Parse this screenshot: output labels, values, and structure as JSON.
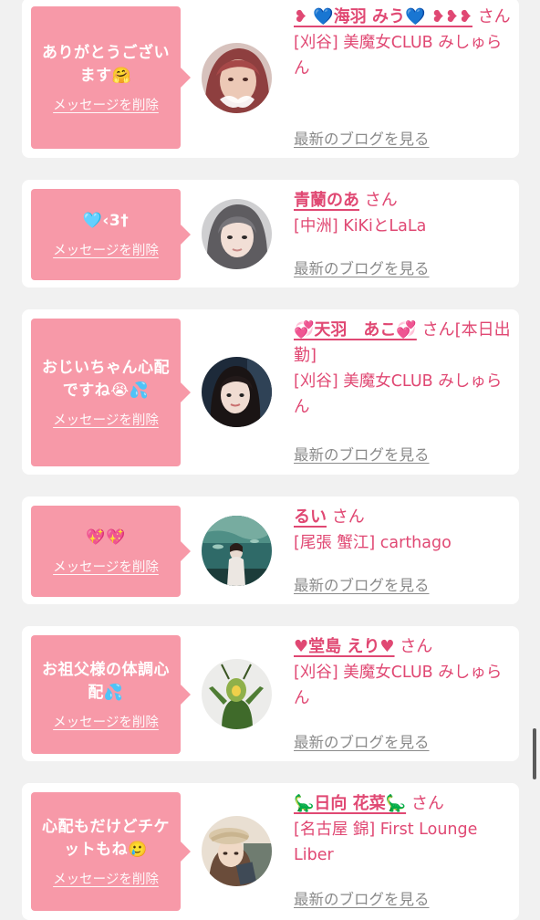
{
  "messages": [
    {
      "bubble_text": "ありがとうござい\nます🤗",
      "delete_label": "メッセージを削除",
      "name": "❥ 💙海羽 みう💙 ❥❥❥",
      "honorific": "さん",
      "extra": "",
      "shop": "[刈谷] 美魔女CLUB みしゅらん",
      "blog_label": "最新のブログを見る",
      "avatar_icon": "woman-portrait-pink-hair"
    },
    {
      "bubble_text": "🩵‹3†",
      "delete_label": "メッセージを削除",
      "name": "青蘭のあ",
      "honorific": "さん",
      "extra": "",
      "shop": "[中洲] KiKiとLaLa",
      "blog_label": "最新のブログを見る",
      "avatar_icon": "woman-portrait-grey-hair"
    },
    {
      "bubble_text": "おじいちゃん心配\nですね😭💦",
      "delete_label": "メッセージを削除",
      "name": "💞天羽　あこ💞",
      "honorific": "さん",
      "extra": "[本日出勤]",
      "shop": "[刈谷] 美魔女CLUB みしゅらん",
      "blog_label": "最新のブログを見る",
      "avatar_icon": "woman-portrait-dark"
    },
    {
      "bubble_text": "💖💖",
      "delete_label": "メッセージを削除",
      "name": "るい",
      "honorific": "さん",
      "extra": "",
      "shop": "[尾張 蟹江] carthago",
      "blog_label": "最新のブログを見る",
      "avatar_icon": "aquarium-photo"
    },
    {
      "bubble_text": "お祖父様の体調心\n配💦",
      "delete_label": "メッセージを削除",
      "name": "♥堂島 えり♥",
      "honorific": "さん",
      "extra": "",
      "shop": "[刈谷] 美魔女CLUB みしゅらん",
      "blog_label": "最新のブログを見る",
      "avatar_icon": "mantis-costume-photo"
    },
    {
      "bubble_text": "心配もだけどチケ\nットもね🥲",
      "delete_label": "メッセージを削除",
      "name": "🦕日向 花菜🦕",
      "honorific": "さん",
      "extra": "",
      "shop": "[名古屋 錦] First Lounge Liber",
      "blog_label": "最新のブログを見る",
      "avatar_icon": "woman-portrait-beret"
    }
  ],
  "colors": {
    "page_bg": "#f1f1f1",
    "card_bg": "#ffffff",
    "bubble_bg": "#f799a8",
    "accent": "#e04873",
    "blog_link": "#8a8a8a"
  }
}
